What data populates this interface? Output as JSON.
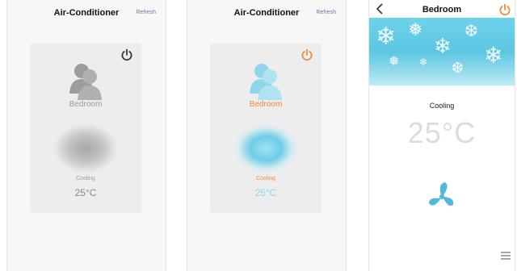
{
  "screens": [
    {
      "nav": {
        "title": "Air-Conditioner",
        "refresh": "Refresh"
      },
      "device": {
        "name": "Bedroom",
        "status": "Cooling",
        "temperature": "25°C",
        "power": "off"
      }
    },
    {
      "nav": {
        "title": "Air-Conditioner",
        "refresh": "Refresh"
      },
      "device": {
        "name": "Bedroom",
        "status": "Cooling",
        "temperature": "25°C",
        "power": "on"
      }
    },
    {
      "nav": {
        "title": "Bedroom",
        "back_icon": "chevron-left-icon",
        "power_icon": "power-icon"
      },
      "detail": {
        "status": "Cooling",
        "temperature": "25°C",
        "fan_icon": "fan-icon",
        "menu_icon": "menu-icon"
      }
    }
  ],
  "colors": {
    "accent_orange": "#ef8a3c",
    "cool_blue": "#6fcde8",
    "muted_gray": "#9a9a9a"
  }
}
